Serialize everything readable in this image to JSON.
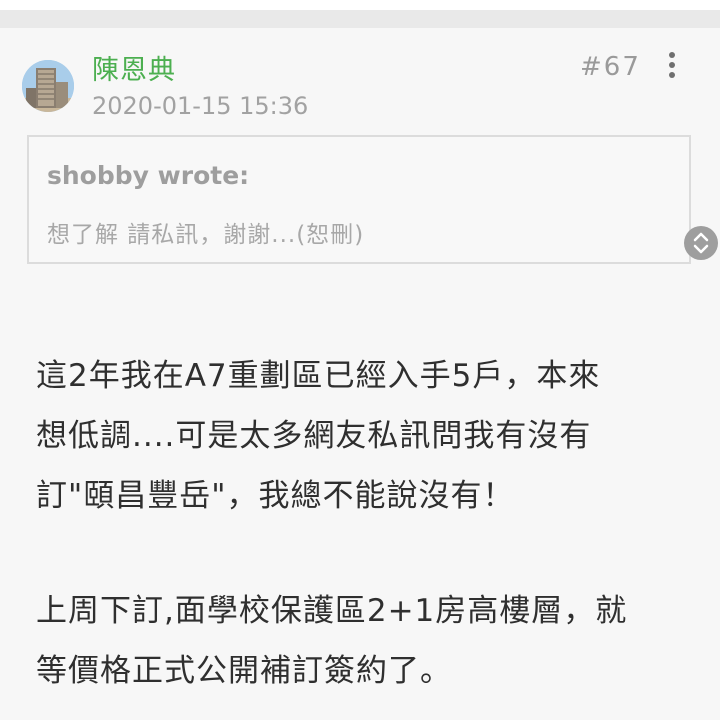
{
  "post": {
    "author": "陳恩典",
    "timestamp": "2020-01-15 15:36",
    "floor": "#67",
    "more_icon": "more-vertical-icon",
    "quote": {
      "author": "shobby wrote:",
      "text": "想了解 請私訊，謝謝...(恕刪)"
    },
    "body": {
      "paragraph1_lines": [
        "這2年我在A7重劃區已經入手5戶，本來",
        "想低調....可是太多網友私訊問我有沒有",
        "訂\"頤昌豐岳\"，我總不能說沒有！"
      ],
      "paragraph2_lines": [
        "上周下訂,面學校保護區2+1房高樓層，就",
        "等價格正式公開補訂簽約了。"
      ]
    }
  },
  "colors": {
    "author": "#4caf50",
    "meta": "#a2a2a2",
    "body_text": "#2f2f2f",
    "quote_border": "#dcdcdc"
  }
}
